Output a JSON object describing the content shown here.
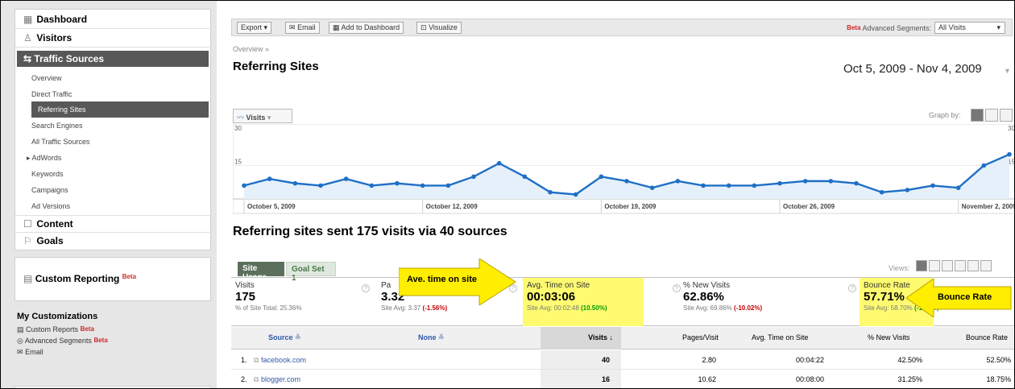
{
  "sidebar": {
    "top_items": [
      {
        "icon": "grid-icon",
        "glyph": "▦",
        "label": "Dashboard"
      },
      {
        "icon": "person-icon",
        "glyph": "♙",
        "label": "Visitors"
      }
    ],
    "active_section": {
      "icon": "traffic-icon",
      "glyph": "⇆",
      "label": "Traffic Sources"
    },
    "sub_items": [
      "Overview",
      "Direct Traffic",
      "Referring Sites",
      "Search Engines",
      "All Traffic Sources",
      "AdWords",
      "Keywords",
      "Campaigns",
      "Ad Versions"
    ],
    "selected_sub": "Referring Sites",
    "bottom_items": [
      {
        "icon": "content-icon",
        "glyph": "☐",
        "label": "Content"
      },
      {
        "icon": "goal-flag-icon",
        "glyph": "⚐",
        "label": "Goals"
      }
    ],
    "custom_reporting": {
      "label": "Custom Reporting",
      "badge": "Beta"
    },
    "my_customizations": {
      "heading": "My Customizations",
      "items": [
        {
          "label": "Custom Reports",
          "badge": "Beta"
        },
        {
          "label": "Advanced Segments",
          "badge": "Beta"
        },
        {
          "label": "Email",
          "badge": ""
        }
      ]
    }
  },
  "toolbar": {
    "export": "Export",
    "email": "Email",
    "add_dashboard": "Add to Dashboard",
    "visualize": "Visualize",
    "beta": "Beta",
    "segments_label": "Advanced Segments:",
    "segments_value": "All Visits"
  },
  "page": {
    "breadcrumb": "Overview »",
    "title": "Referring Sites",
    "date_range": "Oct 5, 2009 - Nov 4, 2009"
  },
  "graph": {
    "metric_select": "Visits",
    "graph_by": "Graph by:"
  },
  "chart_data": {
    "type": "line",
    "series": [
      {
        "name": "Visits",
        "values": [
          6,
          9,
          7,
          6,
          9,
          6,
          7,
          6,
          6,
          10,
          16,
          10,
          3,
          2,
          10,
          8,
          5,
          8,
          6,
          6,
          6,
          7,
          8,
          8,
          7,
          3,
          4,
          6,
          5,
          15,
          20
        ]
      }
    ],
    "x_tick_labels": [
      "October 5, 2009",
      "October 12, 2009",
      "October 19, 2009",
      "October 26, 2009",
      "November 2, 2009"
    ],
    "y_tick_labels_left": [
      "30",
      "15"
    ],
    "y_tick_labels_right": [
      "30",
      "15"
    ],
    "ylim": [
      0,
      30
    ],
    "color": "#1f6fc6",
    "fill_color": "#e6f0fa"
  },
  "summary_heading": "Referring sites sent 175 visits via 40 sources",
  "tabs": {
    "site_usage": "Site Usage",
    "goal_set": "Goal Set 1",
    "views": "Views:"
  },
  "metrics": [
    {
      "label": "Visits",
      "value": "175",
      "sub_prefix": "% of Site Total: 25.36%",
      "sub_delta": "",
      "delta_class": ""
    },
    {
      "label": "Pa",
      "value": "3.32",
      "sub_prefix": "Site Avg: 3.37 ",
      "sub_delta": "(-1.56%)",
      "delta_class": "neg"
    },
    {
      "label": "Avg. Time on Site",
      "value": "00:03:06",
      "sub_prefix": "Site Avg: 00:02:48 ",
      "sub_delta": "(10.50%)",
      "delta_class": "pos"
    },
    {
      "label": "% New Visits",
      "value": "62.86%",
      "sub_prefix": "Site Avg: 69.86% ",
      "sub_delta": "(-10.02%)",
      "delta_class": "neg"
    },
    {
      "label": "Bounce Rate",
      "value": "57.71%",
      "sub_prefix": "Site Avg: 58.70% ",
      "sub_delta": "(-1.07%)",
      "delta_class": "pos"
    }
  ],
  "callouts": {
    "time": "Ave. time on site",
    "bounce": "Bounce Rate"
  },
  "table": {
    "headers": {
      "source": "Source",
      "none": "None",
      "visits": "Visits",
      "pages": "Pages/Visit",
      "avg_time": "Avg. Time on Site",
      "new_visits": "% New Visits",
      "bounce": "Bounce Rate"
    },
    "rows": [
      {
        "n": "1.",
        "source": "facebook.com",
        "visits": "40",
        "pages": "2.80",
        "avg_time": "00:04:22",
        "new_visits": "42.50%",
        "bounce": "52.50%"
      },
      {
        "n": "2.",
        "source": "blogger.com",
        "visits": "16",
        "pages": "10.62",
        "avg_time": "00:08:00",
        "new_visits": "31.25%",
        "bounce": "18.75%"
      }
    ]
  }
}
